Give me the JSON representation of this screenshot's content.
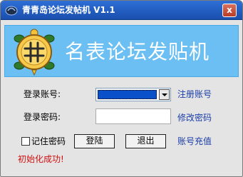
{
  "window": {
    "title": "青青岛论坛发帖机 V1.1",
    "close_symbol": "x"
  },
  "banner": {
    "title": "名表论坛发贴机",
    "logo_icon": "turtle-logo-icon",
    "background_color": "#6cbff2"
  },
  "form": {
    "account_label": "登录账号:",
    "account_value": "",
    "password_label": "登录密码:",
    "password_value": ""
  },
  "links": {
    "register": "注册账号",
    "change_password": "修改密码",
    "recharge": "账号充值"
  },
  "remember": {
    "label": "记住密码",
    "checked": false
  },
  "buttons": {
    "login": "登陆",
    "exit": "退出"
  },
  "status": {
    "text": "初始化成功!",
    "color": "#d01010"
  }
}
